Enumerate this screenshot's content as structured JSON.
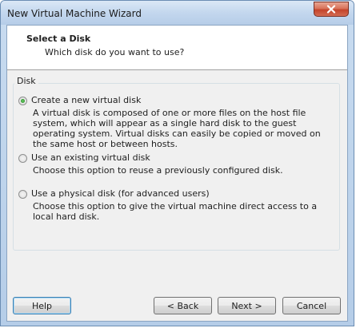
{
  "window": {
    "title": "New Virtual Machine Wizard"
  },
  "header": {
    "title": "Select a Disk",
    "subtitle": "Which disk do you want to use?"
  },
  "disk_group": {
    "label": "Disk",
    "selected": "new",
    "options": [
      {
        "id": "new",
        "label": "Create a new virtual disk",
        "description": "A virtual disk is composed of one or more files on the host file system, which will appear as a single hard disk to the guest operating system. Virtual disks can easily be copied or moved on the same host or between hosts."
      },
      {
        "id": "existing",
        "label": "Use an existing virtual disk",
        "description": "Choose this option to reuse a previously configured disk."
      },
      {
        "id": "physical",
        "label": "Use a physical disk (for advanced users)",
        "description": "Choose this option to give the virtual machine direct access to a local hard disk."
      }
    ]
  },
  "buttons": {
    "help": "Help",
    "back": "< Back",
    "next": "Next >",
    "cancel": "Cancel"
  },
  "icons": {
    "close": "close-icon"
  }
}
